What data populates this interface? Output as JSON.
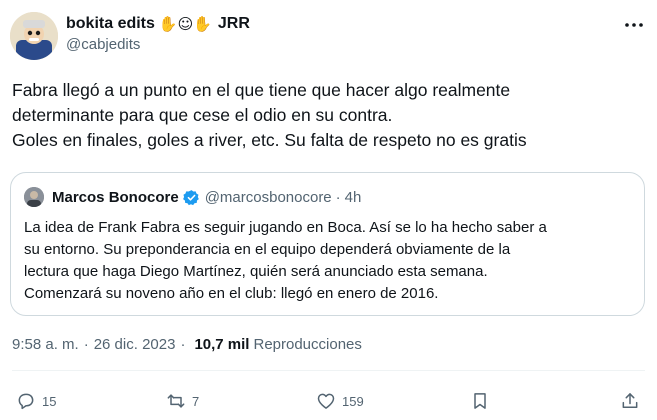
{
  "author": {
    "display_name": "bokita edits",
    "emojis": "✋☺✋",
    "name_suffix": "JRR",
    "handle": "@cabjedits"
  },
  "tweet_lines": [
    "Fabra llegó a un punto en el que tiene que hacer algo realmente",
    "determinante para que cese el odio en su contra.",
    "Goles en finales, goles a river, etc. Su falta de respeto no es gratis"
  ],
  "quote": {
    "name": "Marcos Bonocore",
    "handle": "@marcosbonocore",
    "separator": "·",
    "time": "4h",
    "lines": [
      "La idea de Frank Fabra es seguir jugando en Boca. Así se lo ha hecho saber a",
      "su entorno. Su preponderancia en el equipo dependerá obviamente de la",
      "lectura que haga Diego Martínez, quién será anunciado esta semana.",
      "Comenzará su noveno año en el club: llegó en enero de 2016."
    ]
  },
  "meta": {
    "time": "9:58 a. m.",
    "separator": "·",
    "date": "26 dic. 2023",
    "separator2": "·",
    "views": "10,7 mil",
    "views_label": "Reproducciones"
  },
  "actions": {
    "replies": "15",
    "retweets": "7",
    "likes": "159"
  },
  "colors": {
    "text": "#0f1419",
    "secondary": "#536471",
    "border": "#cfd9de",
    "verified": "#1d9bf0"
  },
  "icons": [
    "more-icon",
    "verified-icon",
    "reply-icon",
    "retweet-icon",
    "like-icon",
    "bookmark-icon",
    "share-icon"
  ]
}
